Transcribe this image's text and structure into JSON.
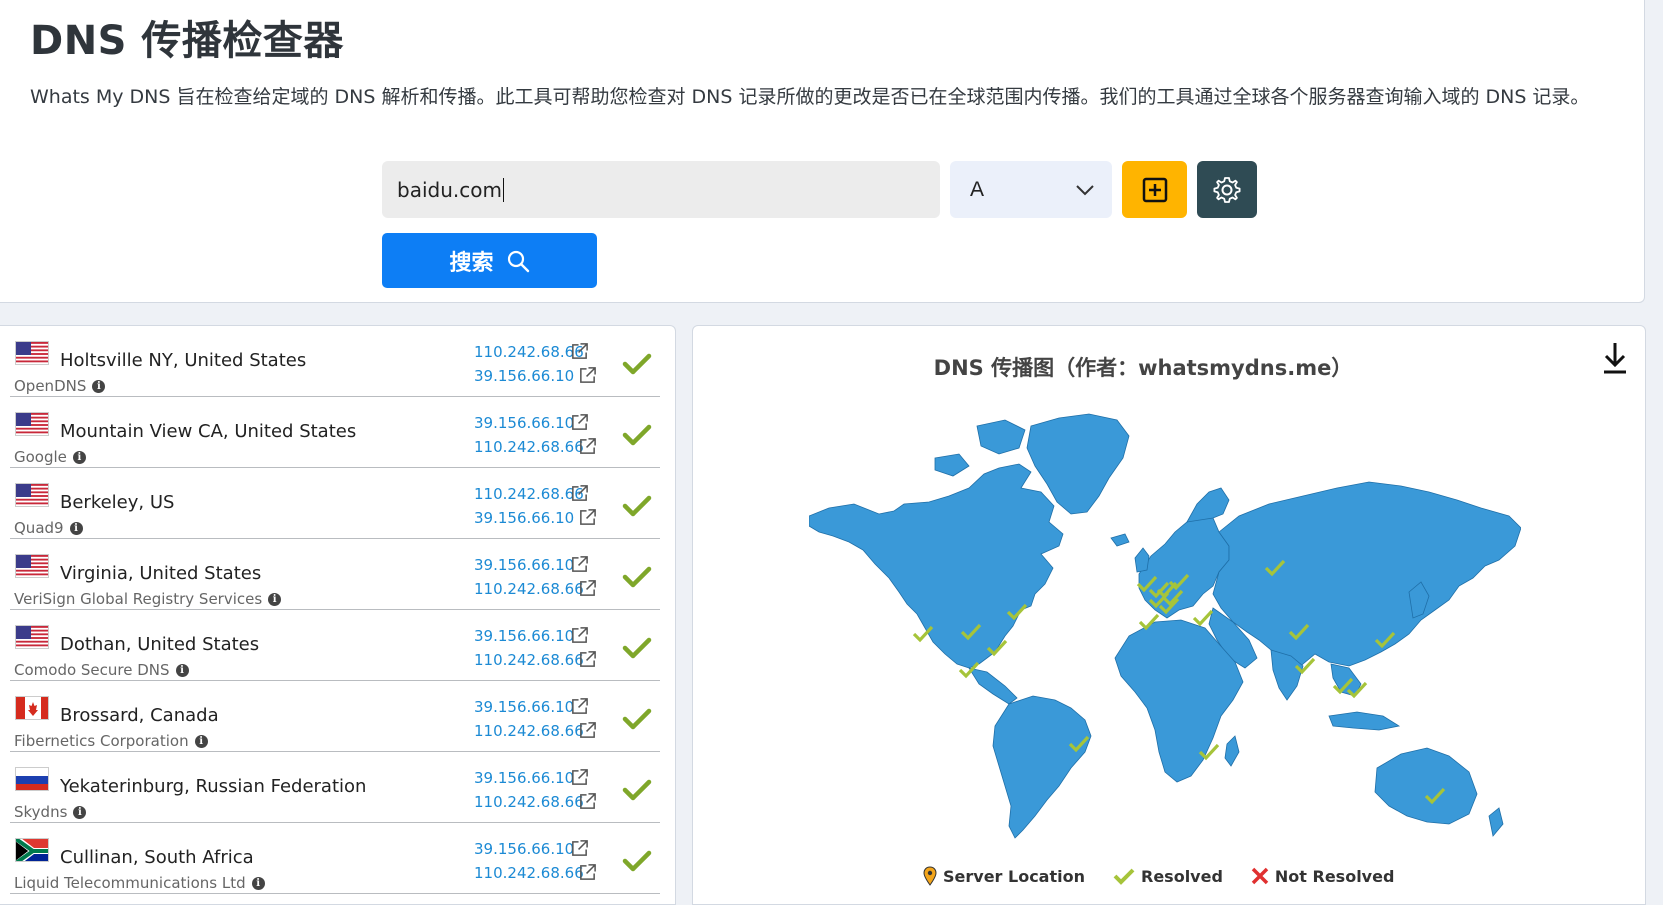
{
  "header": {
    "title": "DNS 传播检查器",
    "intro": "Whats My DNS 旨在检查给定域的 DNS 解析和传播。此工具可帮助您检查对 DNS 记录所做的更改是否已在全球范围内传播。我们的工具通过全球各个服务器查询输入域的 DNS 记录。"
  },
  "search": {
    "domain_value": "baidu.com",
    "record_type": "A",
    "button_label": "搜索"
  },
  "results": [
    {
      "location": "Holtsville NY, United States",
      "provider": "OpenDNS",
      "flag": "us",
      "ips": [
        "110.242.68.66",
        "39.156.66.10"
      ],
      "status": "resolved"
    },
    {
      "location": "Mountain View CA, United States",
      "provider": "Google",
      "flag": "us",
      "ips": [
        "39.156.66.10",
        "110.242.68.66"
      ],
      "status": "resolved"
    },
    {
      "location": "Berkeley, US",
      "provider": "Quad9",
      "flag": "us",
      "ips": [
        "110.242.68.66",
        "39.156.66.10"
      ],
      "status": "resolved"
    },
    {
      "location": "Virginia, United States",
      "provider": "VeriSign Global Registry Services",
      "flag": "us",
      "ips": [
        "39.156.66.10",
        "110.242.68.66"
      ],
      "status": "resolved"
    },
    {
      "location": "Dothan, United States",
      "provider": "Comodo Secure DNS",
      "flag": "us",
      "ips": [
        "39.156.66.10",
        "110.242.68.66"
      ],
      "status": "resolved"
    },
    {
      "location": "Brossard, Canada",
      "provider": "Fibernetics Corporation",
      "flag": "ca",
      "ips": [
        "39.156.66.10",
        "110.242.68.66"
      ],
      "status": "resolved"
    },
    {
      "location": "Yekaterinburg, Russian Federation",
      "provider": "Skydns",
      "flag": "ru",
      "ips": [
        "39.156.66.10",
        "110.242.68.66"
      ],
      "status": "resolved"
    },
    {
      "location": "Cullinan, South Africa",
      "provider": "Liquid Telecommunications Ltd",
      "flag": "za",
      "ips": [
        "39.156.66.10",
        "110.242.68.66"
      ],
      "status": "resolved"
    }
  ],
  "map": {
    "title": "DNS 传播图（作者：whatsmydns.me）",
    "legend": {
      "server_location": "Server Location",
      "resolved": "Resolved",
      "not_resolved": "Not Resolved"
    },
    "colors": {
      "land": "#3a99d8",
      "check": "#a6c43a",
      "cross": "#e03030",
      "pin": "#f3a51b"
    }
  }
}
